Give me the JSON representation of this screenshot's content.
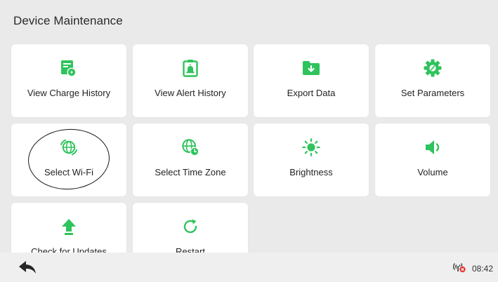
{
  "header": {
    "title": "Device Maintenance"
  },
  "accent_color": "#2fc35d",
  "tiles": [
    {
      "label": "View Charge History",
      "icon": "charge-history-icon"
    },
    {
      "label": "View Alert History",
      "icon": "alert-history-icon"
    },
    {
      "label": "Export Data",
      "icon": "export-folder-icon"
    },
    {
      "label": "Set Parameters",
      "icon": "gear-icon"
    },
    {
      "label": "Select Wi-Fi",
      "icon": "wifi-globe-icon"
    },
    {
      "label": "Select Time Zone",
      "icon": "globe-clock-icon"
    },
    {
      "label": "Brightness",
      "icon": "sun-icon"
    },
    {
      "label": "Volume",
      "icon": "speaker-icon"
    },
    {
      "label": "Check for Updates",
      "icon": "arrow-up-icon"
    },
    {
      "label": "Restart",
      "icon": "refresh-icon"
    }
  ],
  "status": {
    "time": "08:42",
    "network_icon": "network-disconnected-icon"
  },
  "bottom_bar": {
    "back_icon": "back-arrow-icon"
  }
}
